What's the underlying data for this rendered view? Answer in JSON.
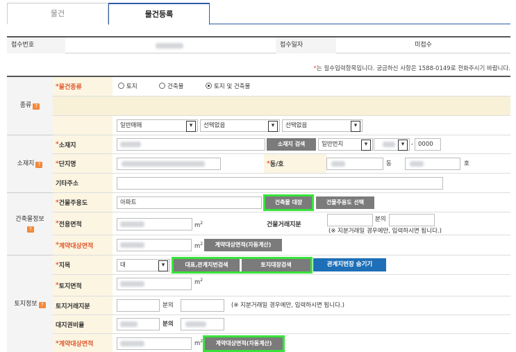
{
  "tabs": [
    "물건",
    "물건등록"
  ],
  "receipt": {
    "no_label": "접수번호",
    "date_label": "접수일자",
    "date_value": "미접수"
  },
  "note": {
    "star": "*",
    "text": "는 필수입력항목입니다. 궁금하신 사항은 1588-0149로 전화주시기 바랍니다."
  },
  "categories": {
    "kind": "종류",
    "location": "소재지",
    "building": "건축물정보",
    "land": "토지정보",
    "q_icon": "?"
  },
  "kind": {
    "label": "물건종류",
    "options": [
      "토지",
      "건축물",
      "토지 및 건축물"
    ],
    "selected_index": 2,
    "selects": [
      "일반매매",
      "선택없음",
      "선택없음"
    ]
  },
  "location": {
    "address_label": "소재지",
    "address_search": "소재지 검색",
    "lot_type": "일반번지",
    "lot_sub": "0000",
    "lot_dash": "-",
    "complex_label": "단지명",
    "dong_label": "동/호",
    "dong_unit": "동",
    "ho_unit": "호",
    "etc_label": "기타주소"
  },
  "building": {
    "use_label": "건물주용도",
    "use_value": "아파트",
    "ledger_btn": "건축물 대장",
    "use_select_btn": "건물주용도 선택",
    "area_label": "전용면적",
    "m2": "m",
    "m2_sup": "2",
    "share_label": "건물거래지분",
    "share_mid": "분의",
    "share_hint": "(※ 지분거래일 경우에만, 입력하시면 됩니다.)",
    "contract_label": "계약대상면적",
    "auto_btn": "계약대상면적(자동계산)"
  },
  "land": {
    "jimok_label": "지목",
    "jimok_value": "대",
    "rep_btn": "대표,관계지번검색",
    "ledger_btn": "토지대장검색",
    "hide_btn": "관계지번장 숨기기",
    "area_label": "토지면적",
    "share_label": "토지거래지분",
    "share_mid": "분의",
    "share_hint": "(※ 지분거래일 경우에만, 입력하시면 됩니다.)",
    "ratio_label": "대지권비율",
    "ratio_mid": "분의",
    "contract_label": "계약대상면적",
    "auto_btn": "계약대상면적(자동계산)"
  },
  "colors": {
    "accent_blue": "#1e6fb7",
    "highlight_green": "#38e43b",
    "required_red": "#e8533a",
    "label_bg": "#fbf5e2"
  }
}
